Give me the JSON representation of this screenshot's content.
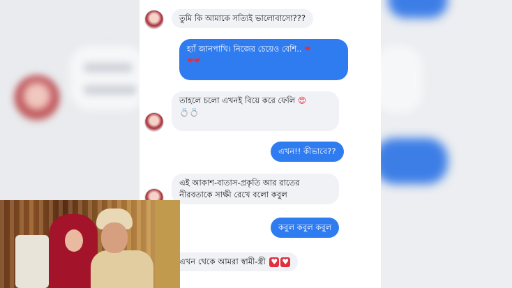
{
  "messages": [
    {
      "id": "m1",
      "side": "in",
      "text": "তুমি কি আমাকে সত্যিই ভালোবাসো???"
    },
    {
      "id": "m2",
      "side": "out",
      "text": "হ্যাঁ জানপাখি। নিজের চেয়েও বেশি..",
      "emoji": "hearts"
    },
    {
      "id": "m3",
      "side": "in",
      "text": "তাহলে চলো এখনই বিয়ে করে ফেলি",
      "emoji": "heart-eyes-rings"
    },
    {
      "id": "m4",
      "side": "out",
      "text": "এখন!! কীভাবে??"
    },
    {
      "id": "m5",
      "side": "in",
      "line1": "এই আকাশ-বাতাস-প্রকৃতি আর রাতের",
      "line2": "নীরবতাকে সাক্ষী রেখে বলো কবুল"
    },
    {
      "id": "m6",
      "side": "out",
      "text": "কবুল কবুল কবুল"
    },
    {
      "id": "m7",
      "side": "in",
      "text": "এখন থেকে আমরা স্বামী-স্ত্রী",
      "emoji": "heart-boxes"
    }
  ],
  "colors": {
    "outgoing_bubble": "#2f7cf0",
    "incoming_bubble": "#f1f2f5",
    "heart": "#e0303f"
  },
  "icons": [
    "avatar",
    "heart-icon",
    "rings-icon",
    "heart-eyes-icon"
  ],
  "photo": {
    "subject": "wedding-couple-photo"
  }
}
